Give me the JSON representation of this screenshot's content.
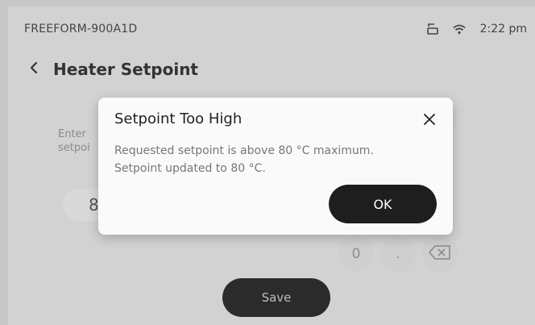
{
  "status_bar": {
    "device_id": "FREEFORM-900A1D",
    "time": "2:22 pm",
    "icons": [
      "printer-icon",
      "wifi-icon"
    ]
  },
  "header": {
    "back_icon": "chevron-left-icon",
    "title": "Heater Setpoint"
  },
  "form": {
    "prompt_line1": "Enter",
    "prompt_line2": "setpoi",
    "value": "8"
  },
  "keypad": {
    "keys": [
      "0",
      "."
    ],
    "backspace_icon": "backspace-icon"
  },
  "save_label": "Save",
  "dialog": {
    "title": "Setpoint Too High",
    "close_icon": "close-icon",
    "message_line1": "Requested setpoint is above 80 °C maximum.",
    "message_line2": "Setpoint updated to 80 °C.",
    "ok_label": "OK"
  }
}
